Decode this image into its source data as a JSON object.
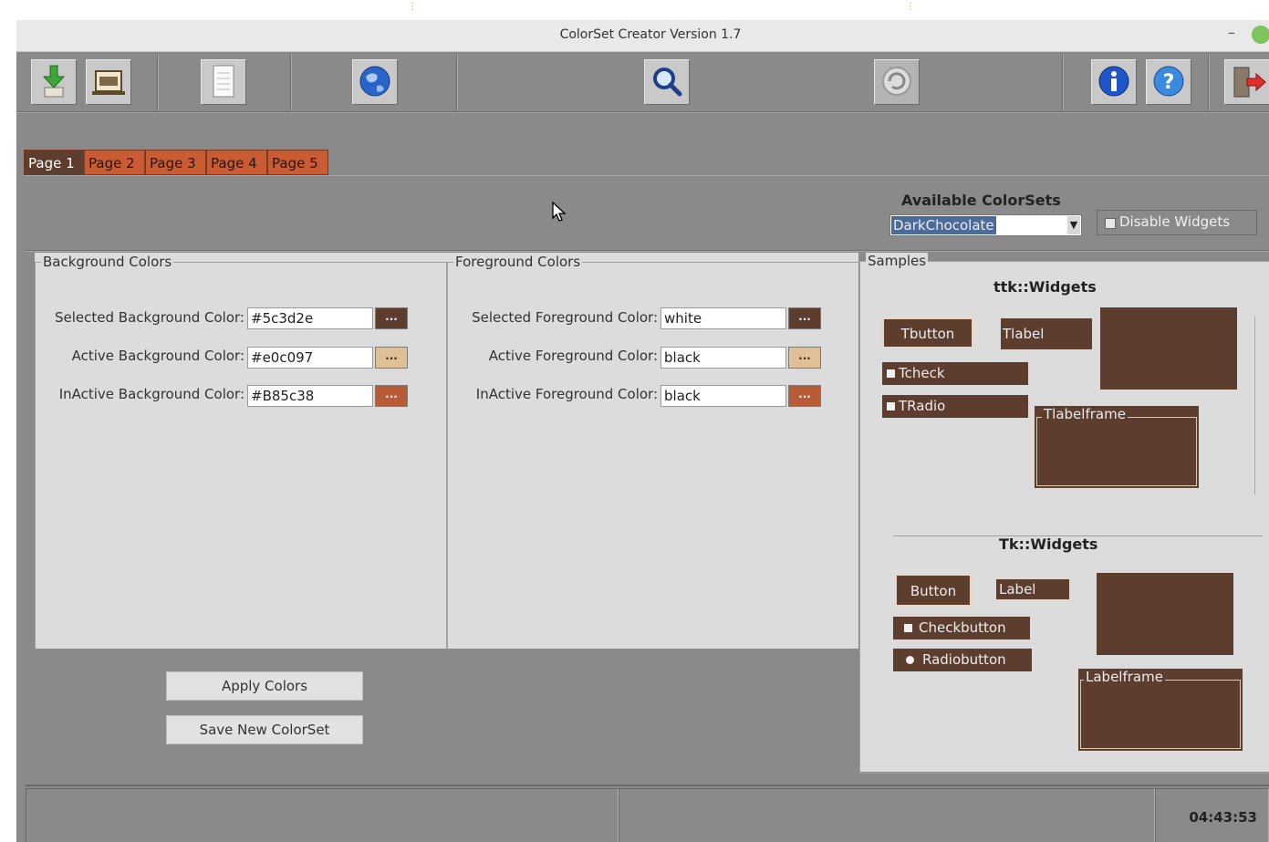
{
  "window": {
    "title": "ColorSet Creator Version 1.7",
    "minimize_glyph": "–"
  },
  "toolbar": {
    "buttons": [
      {
        "icon": "download-icon"
      },
      {
        "icon": "folder-icon"
      },
      {
        "icon": "document-icon"
      },
      {
        "icon": "globe-icon"
      },
      {
        "icon": "search-icon"
      },
      {
        "icon": "refresh-icon"
      },
      {
        "icon": "info-icon"
      },
      {
        "icon": "help-icon"
      },
      {
        "icon": "exit-icon"
      }
    ]
  },
  "tabs": [
    "Page 1",
    "Page 2",
    "Page 3",
    "Page 4",
    "Page 5"
  ],
  "colorsets": {
    "label": "Available ColorSets",
    "selected": "DarkChocolate",
    "disable_label": "Disable Widgets"
  },
  "background": {
    "legend": "Background Colors",
    "rows": [
      {
        "label": "Selected Background Color:",
        "value": "#5c3d2e",
        "swatch": "#5c3d2e",
        "glyph": "..."
      },
      {
        "label": "Active Background Color:",
        "value": "#e0c097",
        "swatch": "#e0c097",
        "glyph": "..."
      },
      {
        "label": "InActive Background Color:",
        "value": "#B85c38",
        "swatch": "#B85c38",
        "glyph": "..."
      }
    ]
  },
  "foreground": {
    "legend": "Foreground Colors",
    "rows": [
      {
        "label": "Selected Foreground Color:",
        "value": "white",
        "swatch": "#5c3d2e",
        "glyph": "..."
      },
      {
        "label": "Active Foreground Color:",
        "value": "black",
        "swatch": "#e0c097",
        "glyph": "..."
      },
      {
        "label": "InActive Foreground Color:",
        "value": "black",
        "swatch": "#B85c38",
        "glyph": "..."
      }
    ]
  },
  "actions": {
    "apply": "Apply Colors",
    "save": "Save New ColorSet"
  },
  "samples": {
    "legend": "Samples",
    "ttk_title": "ttk::Widgets",
    "ttk": {
      "button": "Tbutton",
      "label": "Tlabel",
      "check": "Tcheck",
      "radio": "TRadio",
      "labelframe": "Tlabelframe"
    },
    "tk_title": "Tk::Widgets",
    "tk": {
      "button": "Button",
      "label": "Label",
      "check": "Checkbutton",
      "radio": "Radiobutton",
      "labelframe": "Labelframe"
    }
  },
  "status": {
    "clock": "04:43:53"
  }
}
